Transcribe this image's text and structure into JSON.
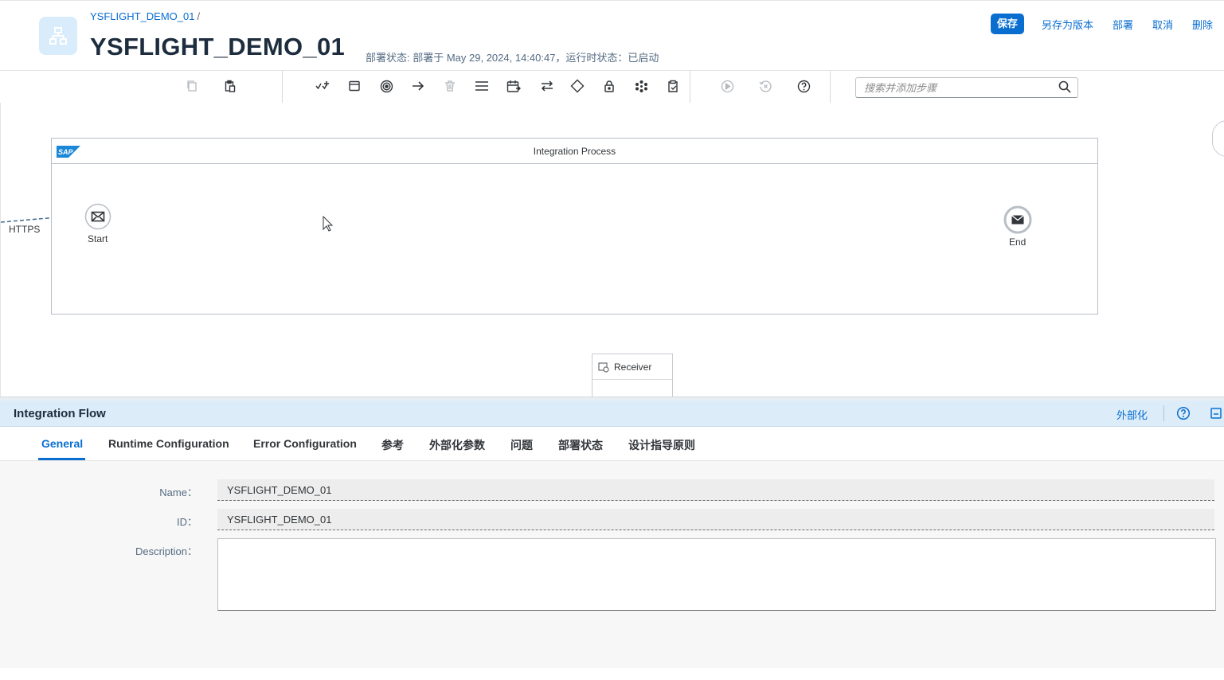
{
  "header": {
    "breadcrumb": "YSFLIGHT_DEMO_01",
    "breadcrumb_sep": "/",
    "title": "YSFLIGHT_DEMO_01",
    "status": "部署状态: 部署于 May 29, 2024, 14:40:47，运行时状态：已启动",
    "actions": {
      "save": "保存",
      "save_as_version": "另存为版本",
      "deploy": "部署",
      "cancel": "取消",
      "delete": "删除"
    }
  },
  "toolbar": {
    "icons": [
      "copy-icon",
      "paste-icon",
      "participants-icon",
      "process-icon",
      "events-icon",
      "connector-icon",
      "delete-icon",
      "menu-icon",
      "calls-icon",
      "mapping-icon",
      "routing-icon",
      "security-icon",
      "transformation-icon",
      "validator-icon",
      "simulate-icon",
      "reset-icon",
      "help-icon"
    ],
    "search_placeholder": "搜索并添加步骤"
  },
  "canvas": {
    "pool_title": "Integration Process",
    "start_label": "Start",
    "end_label": "End",
    "sender_channel": "HTTPS",
    "receiver_label": "Receiver"
  },
  "panel": {
    "title": "Integration Flow",
    "externalize": "外部化",
    "tabs": [
      "General",
      "Runtime Configuration",
      "Error Configuration",
      "参考",
      "外部化参数",
      "问题",
      "部署状态",
      "设计指导原则"
    ],
    "active_tab": "General",
    "fields": {
      "name_label": "Name",
      "name_value": "YSFLIGHT_DEMO_01",
      "id_label": "ID",
      "id_value": "YSFLIGHT_DEMO_01",
      "description_label": "Description",
      "description_value": "",
      "colon": "："
    }
  }
}
